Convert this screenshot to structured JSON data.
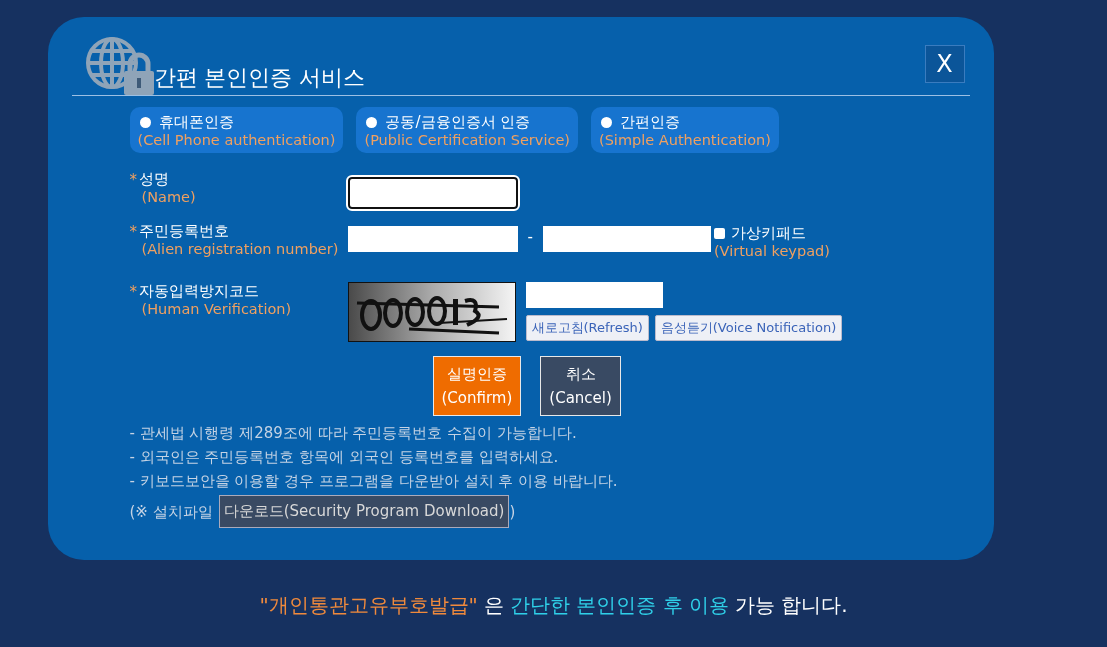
{
  "dialog": {
    "title": "간편 본인인증 서비스",
    "close_label": "X",
    "auth_options": [
      {
        "label": "휴대폰인증",
        "sublabel": "(Cell Phone authentication)",
        "selected": false
      },
      {
        "label": "공동/금융인증서 인증",
        "sublabel": "(Public Certification Service)",
        "selected": false
      },
      {
        "label": "간편인증",
        "sublabel": "(Simple Authentication)",
        "selected": false
      }
    ],
    "fields": [
      {
        "kind": "name",
        "required_mark": "*",
        "label": "성명",
        "sublabel": "(Name)"
      },
      {
        "kind": "registration",
        "required_mark": "*",
        "label": "주민등록번호",
        "sublabel": "(Alien registration number)",
        "separator": "-",
        "keypad": {
          "label": "가상키패드",
          "sublabel": "(Virtual keypad)",
          "checked": false
        }
      },
      {
        "kind": "captcha",
        "required_mark": "*",
        "label": "자동입력방지코드",
        "sublabel": "(Human Verification)",
        "captcha": {
          "kind": "picture"
        },
        "buttons": [
          "새로고침(Refresh)",
          "음성듣기(Voice Notification)"
        ]
      }
    ],
    "actions": [
      {
        "kind": "confirm",
        "label": "실명인증",
        "sublabel": "(Confirm)"
      },
      {
        "kind": "cancel",
        "label": "취소",
        "sublabel": "(Cancel)"
      }
    ],
    "notes": [
      "- 관세법 시행령 제289조에 따라 주민등록번호 수집이 가능합니다.",
      "- 외국인은 주민등록번호 항목에 외국인 등록번호를 입력하세요.",
      "- 키보드보안을 이용할 경우 프로그램을 다운받아 설치 후 이용 바랍니다."
    ],
    "download": {
      "prefix": "(※ 설치파일",
      "button": "다운로드(Security Program Download)",
      "suffix": ")"
    }
  },
  "footer": [
    {
      "text": "\"개인통관고유부호발급\"",
      "color": "#f08a3c"
    },
    {
      "text": "은",
      "color": "#ffffff"
    },
    {
      "text": "간단한 본인인증 후 이용",
      "color": "#2fd0e8"
    },
    {
      "text": "가능 합니다.",
      "color": "#ffffff"
    }
  ]
}
